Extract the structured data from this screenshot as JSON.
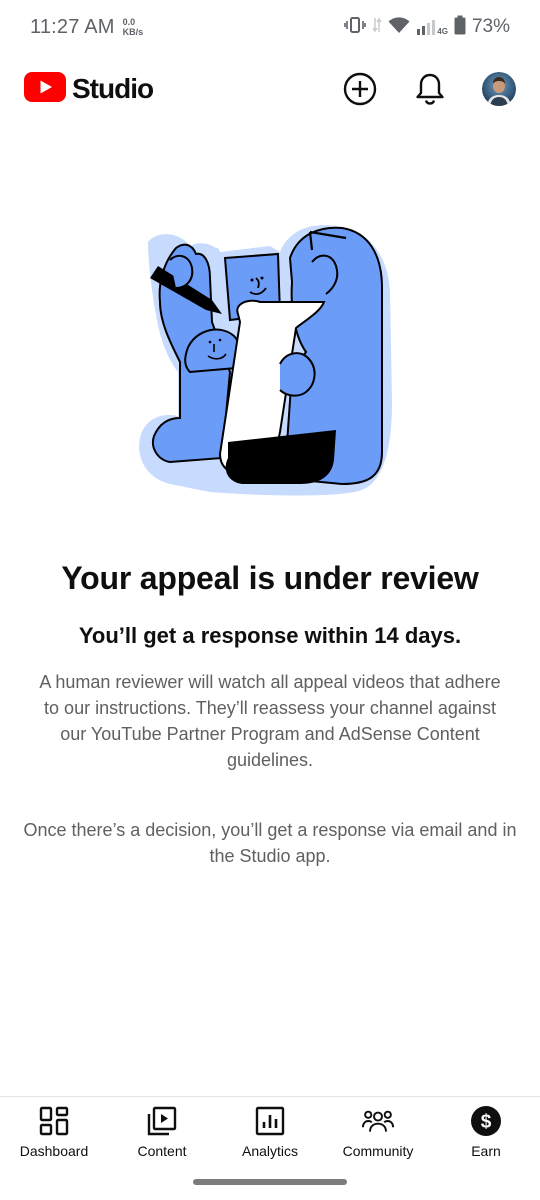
{
  "status_bar": {
    "time": "11:27 AM",
    "net_speed_value": "0.0",
    "net_speed_unit": "KB/s",
    "network_type": "4G",
    "battery": "73%"
  },
  "app_bar": {
    "logo_text": "Studio",
    "brand_color": "#ff0000",
    "icons": [
      "create-icon",
      "notifications-icon",
      "avatar"
    ]
  },
  "main": {
    "title": "Your appeal is under review",
    "subtitle": "You’ll get a response within 14 days.",
    "description": "A human reviewer will watch all appeal videos that adhere to our instructions. They’ll reassess your channel against our YouTube Partner Program and AdSense Content guidelines.",
    "note": "Once there’s a decision, you’ll get a response via email and in the Studio app.",
    "illustration_colors": {
      "primary": "#6b9cf7",
      "halo": "#c7dbff",
      "ink": "#000000"
    }
  },
  "bottom_nav": {
    "items": [
      {
        "label": "Dashboard",
        "icon": "dashboard-icon"
      },
      {
        "label": "Content",
        "icon": "content-icon"
      },
      {
        "label": "Analytics",
        "icon": "analytics-icon"
      },
      {
        "label": "Community",
        "icon": "community-icon"
      },
      {
        "label": "Earn",
        "icon": "earn-icon"
      }
    ]
  }
}
